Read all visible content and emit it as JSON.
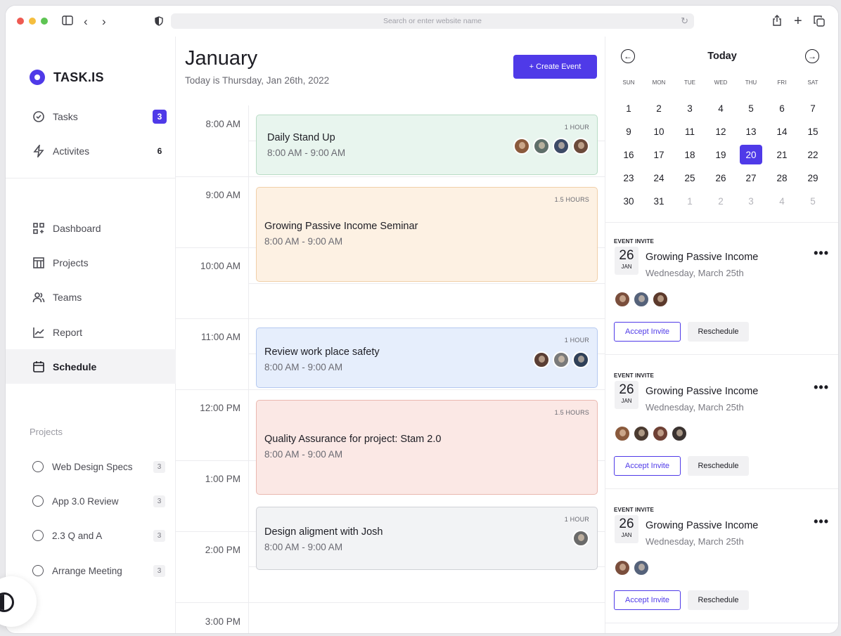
{
  "browser": {
    "address_placeholder": "Search or enter website name"
  },
  "brand": {
    "name": "TASK.IS",
    "accent": "#4f3ae8"
  },
  "sidebar": {
    "top": [
      {
        "label": "Tasks",
        "count": "3"
      },
      {
        "label": "Activites",
        "count": "6"
      }
    ],
    "nav": [
      {
        "label": "Dashboard"
      },
      {
        "label": "Projects"
      },
      {
        "label": "Teams"
      },
      {
        "label": "Report"
      },
      {
        "label": "Schedule"
      }
    ],
    "projects_heading": "Projects",
    "projects": [
      {
        "label": "Web Design Specs",
        "count": "3"
      },
      {
        "label": "App 3.0 Review",
        "count": "3"
      },
      {
        "label": "2.3 Q and A",
        "count": "3"
      },
      {
        "label": "Arrange Meeting",
        "count": "3"
      }
    ]
  },
  "main": {
    "month": "January",
    "today": "Today is Thursday, Jan 26th, 2022",
    "create_button": "+ Create Event",
    "times": [
      "8:00 AM",
      "9:00 AM",
      "10:00 AM",
      "11:00 AM",
      "12:00 PM",
      "1:00 PM",
      "2:00 PM",
      "3:00 PM"
    ],
    "events": [
      {
        "title": "Daily Stand Up",
        "time": "8:00 AM - 9:00 AM",
        "duration": "1 HOUR"
      },
      {
        "title": "Growing Passive Income Seminar",
        "time": "8:00 AM - 9:00 AM",
        "duration": "1.5 HOURS"
      },
      {
        "title": "Review work place safety",
        "time": "8:00 AM - 9:00 AM",
        "duration": "1 HOUR"
      },
      {
        "title": "Quality Assurance for project: Stam 2.0",
        "time": "8:00 AM - 9:00 AM",
        "duration": "1.5 HOURS"
      },
      {
        "title": "Design aligment with Josh",
        "time": "8:00 AM - 9:00 AM",
        "duration": "1 HOUR"
      }
    ]
  },
  "calendar": {
    "title": "Today",
    "weekdays": [
      "SUN",
      "MON",
      "TUE",
      "WED",
      "THU",
      "FRI",
      "SAT"
    ],
    "weeks": [
      [
        "1",
        "2",
        "3",
        "4",
        "5",
        "6",
        "7"
      ],
      [
        "9",
        "10",
        "11",
        "12",
        "13",
        "14",
        "15"
      ],
      [
        "16",
        "17",
        "18",
        "19",
        "20",
        "21",
        "22"
      ],
      [
        "23",
        "24",
        "25",
        "26",
        "27",
        "28",
        "29"
      ],
      [
        "30",
        "31",
        "1",
        "2",
        "3",
        "4",
        "5"
      ]
    ],
    "selected": "20"
  },
  "invites": [
    {
      "heading": "EVENT INVITE",
      "day": "26",
      "month": "JAN",
      "title": "Growing Passive Income",
      "date": "Wednesday, March 25th",
      "accept": "Accept Invite",
      "reschedule": "Reschedule"
    },
    {
      "heading": "EVENT INVITE",
      "day": "26",
      "month": "JAN",
      "title": "Growing Passive Income",
      "date": "Wednesday, March 25th",
      "accept": "Accept Invite",
      "reschedule": "Reschedule"
    },
    {
      "heading": "EVENT INVITE",
      "day": "26",
      "month": "JAN",
      "title": "Growing Passive Income",
      "date": "Wednesday, March 25th",
      "accept": "Accept Invite",
      "reschedule": "Reschedule"
    }
  ],
  "more_label": "•••"
}
